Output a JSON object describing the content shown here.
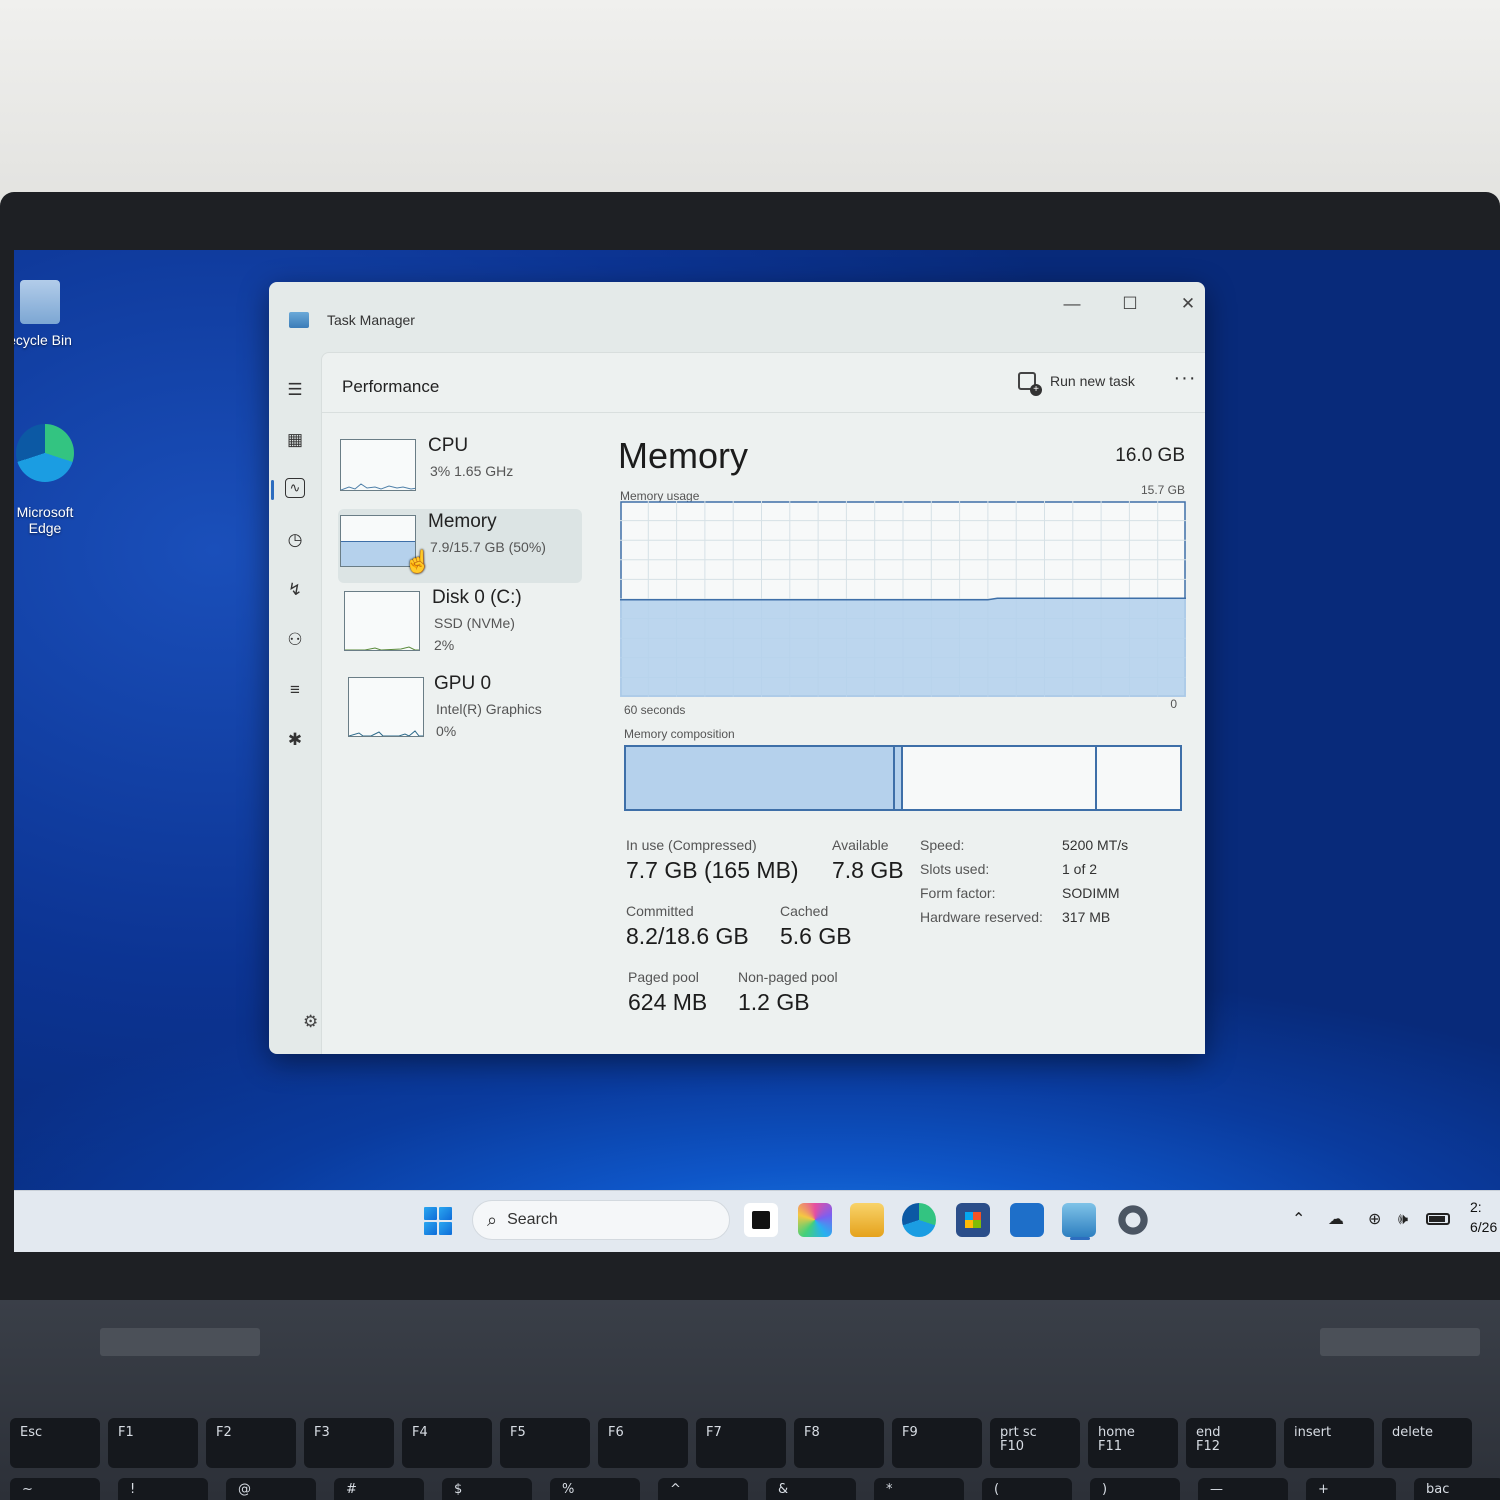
{
  "desktop": {
    "icons": [
      {
        "label": "ecycle Bin"
      },
      {
        "label": "Microsoft\nEdge"
      }
    ]
  },
  "window": {
    "title": "Task Manager",
    "controls": {
      "minimize": "—",
      "maximize": "☐",
      "close": "✕"
    }
  },
  "nav": {
    "icons": [
      "hamburger-icon",
      "processes-icon",
      "performance-icon",
      "app-history-icon",
      "startup-apps-icon",
      "users-icon",
      "details-icon",
      "services-icon",
      "settings-icon"
    ]
  },
  "header": {
    "page_title": "Performance",
    "run_task_label": "Run new task",
    "more_label": "···"
  },
  "resources": [
    {
      "name": "CPU",
      "sub1": "3%  1.65 GHz",
      "sub2": ""
    },
    {
      "name": "Memory",
      "sub1": "7.9/15.7 GB (50%)",
      "sub2": ""
    },
    {
      "name": "Disk 0 (C:)",
      "sub1": "SSD (NVMe)",
      "sub2": "2%"
    },
    {
      "name": "GPU 0",
      "sub1": "Intel(R) Graphics",
      "sub2": "0%"
    }
  ],
  "memory": {
    "title": "Memory",
    "total": "16.0 GB",
    "usage_label": "Memory usage",
    "usage_max": "15.7 GB",
    "time_label": "60 seconds",
    "zero_label": "0",
    "usage_fraction": 0.5,
    "composition_label": "Memory composition",
    "composition": {
      "in_use": 0.485,
      "modified": 0.014,
      "standby": 0.35,
      "free": 0.151
    },
    "stats": {
      "in_use_label": "In use (Compressed)",
      "in_use_value": "7.7 GB (165 MB)",
      "available_label": "Available",
      "available_value": "7.8 GB",
      "committed_label": "Committed",
      "committed_value": "8.2/18.6 GB",
      "cached_label": "Cached",
      "cached_value": "5.6 GB",
      "paged_label": "Paged pool",
      "paged_value": "624 MB",
      "nonpaged_label": "Non-paged pool",
      "nonpaged_value": "1.2 GB"
    },
    "specs": [
      {
        "label": "Speed:",
        "value": "5200 MT/s"
      },
      {
        "label": "Slots used:",
        "value": "1 of 2"
      },
      {
        "label": "Form factor:",
        "value": "SODIMM"
      },
      {
        "label": "Hardware reserved:",
        "value": "317 MB"
      }
    ]
  },
  "taskbar": {
    "search_placeholder": "Search",
    "apps": [
      "task-view-icon",
      "m365-icon",
      "file-explorer-icon",
      "edge-icon",
      "store-icon",
      "company-portal-icon",
      "task-manager-icon",
      "settings-icon"
    ],
    "clock_time": "2:",
    "clock_date": "6/26"
  },
  "keyboard": {
    "fkeys": [
      "Esc",
      "F1",
      "F2",
      "F3",
      "F4",
      "F5",
      "F6",
      "F7",
      "F8",
      "F9",
      "prt sc\nF10",
      "home\nF11",
      "end\nF12",
      "insert",
      "delete"
    ],
    "numrow": [
      "~",
      "!",
      "@",
      "#",
      "$",
      "%",
      "^",
      "&",
      "*",
      "(",
      ")",
      "—",
      "+",
      "bac"
    ]
  },
  "colors": {
    "accent": "#2d6dbf",
    "graph_fill": "#b5d1ec",
    "graph_line": "#3e6fa8"
  }
}
